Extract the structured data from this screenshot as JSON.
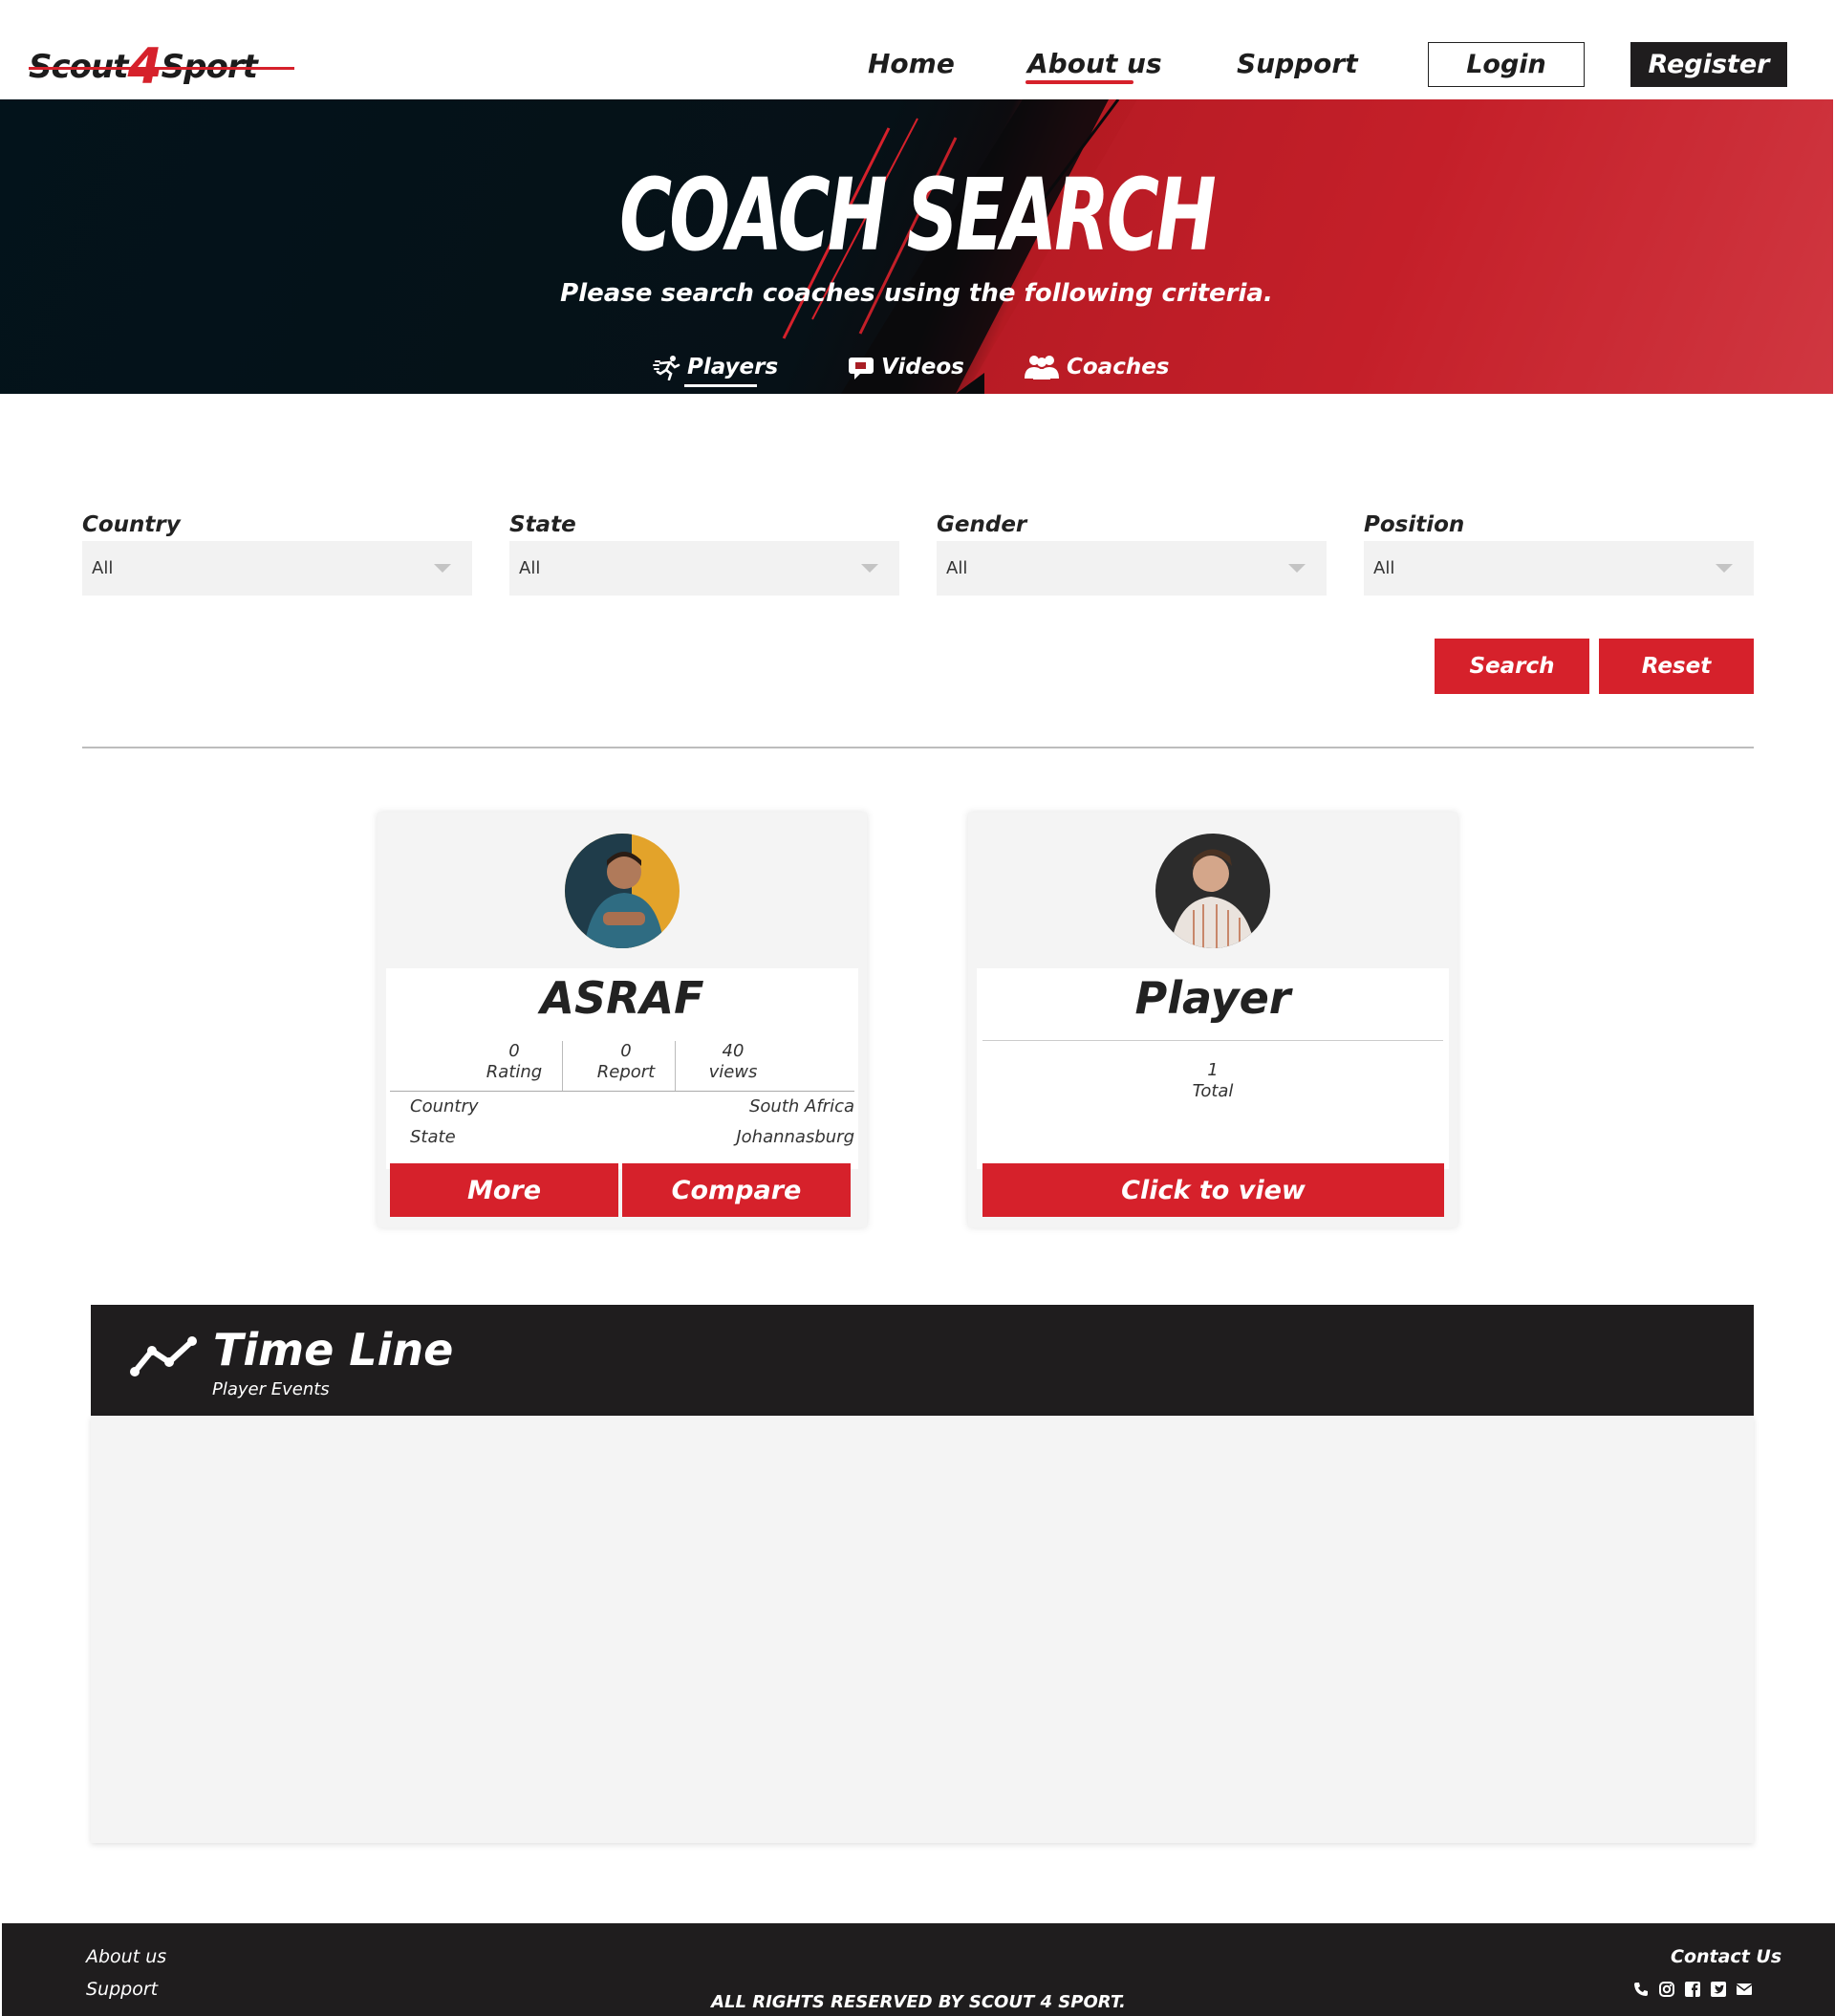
{
  "header": {
    "logo_text_left": "Scout",
    "logo_text_four": "4",
    "logo_text_right": "Sport",
    "nav": [
      {
        "label": "Home"
      },
      {
        "label": "About us"
      },
      {
        "label": "Support"
      }
    ],
    "login_label": "Login",
    "register_label": "Register"
  },
  "hero": {
    "title": "COACH SEARCH",
    "subtitle": "Please search coaches using the following criteria.",
    "tabs": [
      {
        "label": "Players",
        "icon": "running-person-icon"
      },
      {
        "label": "Videos",
        "icon": "video-chat-icon"
      },
      {
        "label": "Coaches",
        "icon": "group-icon"
      }
    ]
  },
  "filters": {
    "fields": [
      {
        "label": "Country",
        "value": "All"
      },
      {
        "label": "State",
        "value": "All"
      },
      {
        "label": "Gender",
        "value": "All"
      },
      {
        "label": "Position",
        "value": "All"
      }
    ],
    "search_label": "Search",
    "reset_label": "Reset"
  },
  "cards": [
    {
      "name": "ASRAF",
      "stats": [
        {
          "value": "0",
          "label": "Rating"
        },
        {
          "value": "0",
          "label": "Report"
        },
        {
          "value": "40",
          "label": "views"
        }
      ],
      "details": [
        {
          "key": "Country",
          "value": "South Africa"
        },
        {
          "key": "State",
          "value": "Johannasburg"
        }
      ],
      "more_label": "More",
      "compare_label": "Compare"
    },
    {
      "name": "Player",
      "total_value": "1",
      "total_label": "Total",
      "view_label": "Click to view"
    }
  ],
  "timeline": {
    "title": "Time Line",
    "subtitle": "Player Events",
    "icon": "line-chart-icon"
  },
  "footer": {
    "links": [
      "About us",
      "Support"
    ],
    "copyright": "ALL RIGHTS RESERVED BY SCOUT 4 SPORT.",
    "contact_label": "Contact Us",
    "social_icons": [
      "phone-icon",
      "instagram-icon",
      "facebook-icon",
      "twitter-icon",
      "mail-icon"
    ]
  },
  "colors": {
    "accent": "#d6212b",
    "dark": "#1f1d1e",
    "panel": "#f4f4f4"
  }
}
